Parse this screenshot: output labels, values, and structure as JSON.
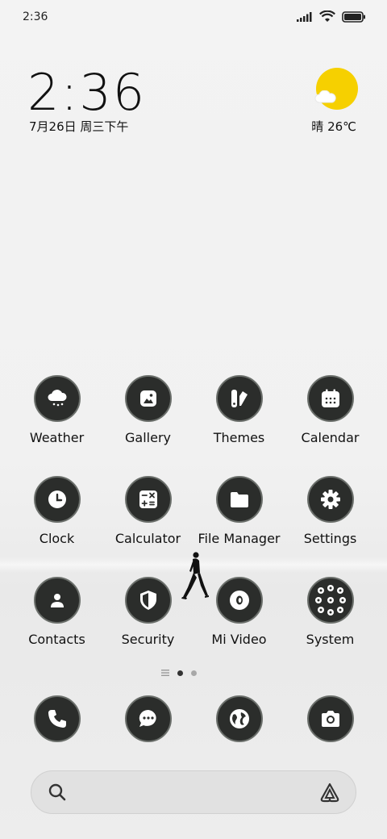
{
  "status": {
    "time": "2:36"
  },
  "widget": {
    "time": "2:36",
    "date": "7月26日 周三下午",
    "weather": "晴 26℃",
    "sun_color": "#f6d000"
  },
  "apps": [
    {
      "label": "Weather",
      "icon": "weather-icon"
    },
    {
      "label": "Gallery",
      "icon": "gallery-icon"
    },
    {
      "label": "Themes",
      "icon": "themes-icon"
    },
    {
      "label": "Calendar",
      "icon": "calendar-icon"
    },
    {
      "label": "Clock",
      "icon": "clock-icon"
    },
    {
      "label": "Calculator",
      "icon": "calculator-icon"
    },
    {
      "label": "File Manager",
      "icon": "folder-icon"
    },
    {
      "label": "Settings",
      "icon": "gear-icon"
    },
    {
      "label": "Contacts",
      "icon": "contacts-icon"
    },
    {
      "label": "Security",
      "icon": "shield-icon"
    },
    {
      "label": "Mi Video",
      "icon": "video-icon"
    },
    {
      "label": "System",
      "icon": "system-folder-icon"
    }
  ],
  "dock": [
    {
      "icon": "phone-icon"
    },
    {
      "icon": "message-icon"
    },
    {
      "icon": "browser-icon"
    },
    {
      "icon": "camera-icon"
    }
  ],
  "pager": {
    "pages": 2,
    "current": 1
  },
  "colors": {
    "icon_bg": "#2b2d2b",
    "icon_ring": "#6b6f6b",
    "icon_glyph": "#ffffff"
  }
}
